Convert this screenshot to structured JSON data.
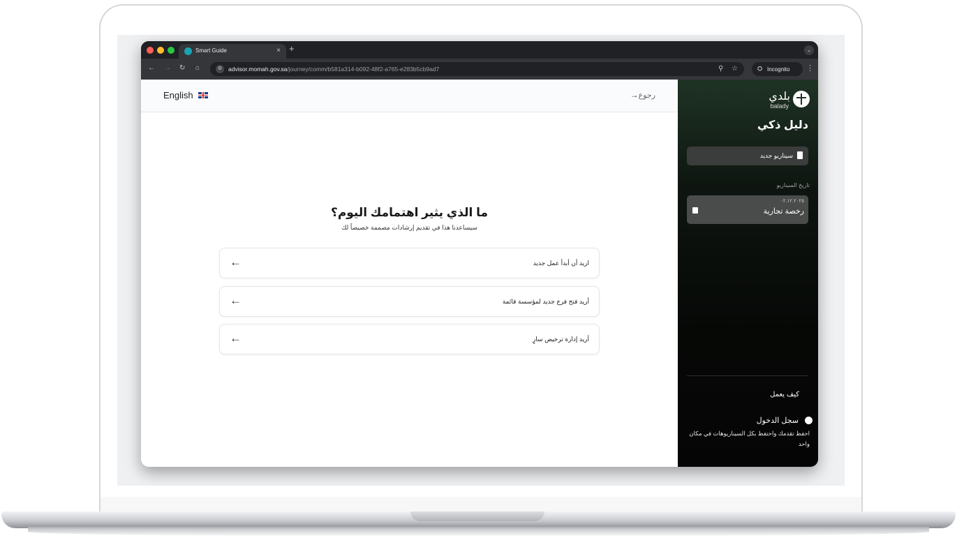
{
  "browser": {
    "tab_title": "Smart Guide",
    "tab_close": "×",
    "new_tab": "+",
    "url_host": "advisor.momah.gov.sa",
    "url_path": "/journey/comm/b581a314-b092-48f2-a765-e283b5cb9ad7",
    "incognito_label": "Incognito",
    "icons": [
      "back-icon",
      "forward-icon",
      "reload-icon",
      "home-icon",
      "site-info-icon",
      "zoom-icon",
      "star-icon",
      "incognito-icon",
      "menu-icon"
    ],
    "traffic_colors": [
      "#ff5f57",
      "#febc2e",
      "#28c840"
    ]
  },
  "header": {
    "language": "English",
    "back_label": "رجوع",
    "back_arrow": "→"
  },
  "main": {
    "title": "ما الذي يثير اهتمامك اليوم؟",
    "subtitle": "سيساعدنا هذا في تقديم إرشادات مصممة خصيصاً لك",
    "options": [
      {
        "label": "اريد أن أبدأ عمل جديد",
        "arrow": "←"
      },
      {
        "label": "أريد فتح فرع جديد لمؤسسة قائمة",
        "arrow": "←"
      },
      {
        "label": "أريد إدارة ترخيص سارٍ",
        "arrow": "←"
      }
    ]
  },
  "sidebar": {
    "logo_ar": "بلدي",
    "logo_en": "balady",
    "app_title": "دليل ذكي",
    "new_scenario": "سيناريو جديد",
    "history_label": "تاريخ السيناريو",
    "history": [
      {
        "date": "٠٢.١٢.٢٠٢٥",
        "name": "رخصة تجارية"
      }
    ],
    "how_it_works": "كيف يعمل",
    "login": "سجل الدخول",
    "login_desc": "احفظ تقدمك واحتفظ بكل السيناريوهات في مكان واحد"
  },
  "colors": {
    "sidebar_top": "#1f3325",
    "sidebar_bottom": "#050505",
    "page_bg": "#ffffff",
    "browser_chrome": "#202124"
  }
}
